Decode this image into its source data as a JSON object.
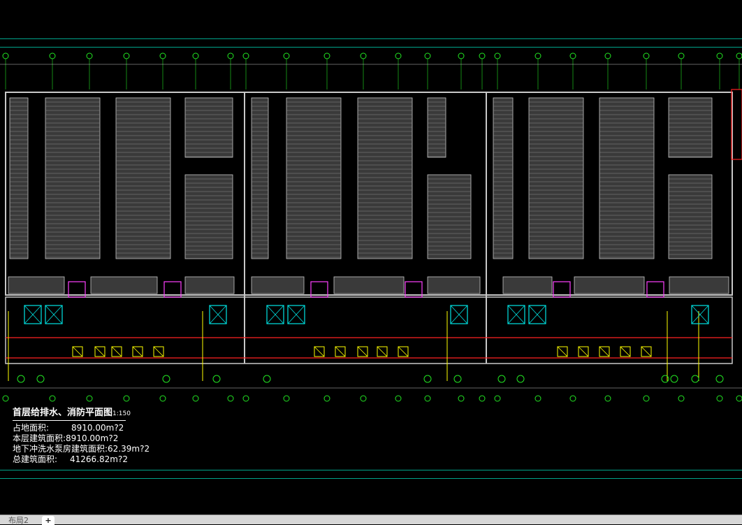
{
  "drawing": {
    "colors": {
      "background": "#000000",
      "frame": "#00a38a",
      "axis": "#22e522",
      "wall": "#c8c8c8",
      "water_supply": "#ff2222",
      "fire": "#ffff00",
      "equipment": "#00e5e5",
      "door": "#ff40ff",
      "text": "#ffffff"
    },
    "title": "首层给排水、消防平面图",
    "scale": "1:150",
    "stats": [
      {
        "label": "占地面积:",
        "value": "8910.00m?2"
      },
      {
        "label": "本层建筑面积:",
        "value": "8910.00m?2"
      },
      {
        "label": "地下冲洗水泵房建筑面积:",
        "value": "62.39m?2"
      },
      {
        "label": "总建筑面积:",
        "value": "41266.82m?2"
      }
    ]
  },
  "tabs": {
    "layout2": "布局2",
    "add": "+"
  }
}
